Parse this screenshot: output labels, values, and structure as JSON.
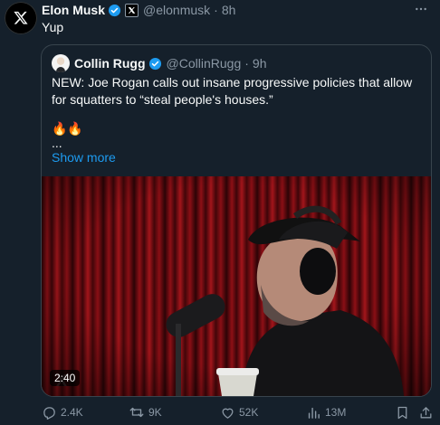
{
  "tweet": {
    "author_name": "Elon Musk",
    "author_handle": "@elonmusk",
    "separator": "·",
    "time": "8h",
    "text": "Yup",
    "more_icon": "ellipsis-icon"
  },
  "quoted": {
    "author_name": "Collin Rugg",
    "author_handle": "@CollinRugg",
    "separator": "·",
    "time": "9h",
    "text": "NEW: Joe Rogan calls out insane progressive policies that allow for squatters to “steal people's houses.”",
    "emoji": "🔥🔥",
    "ellipsis": "...",
    "show_more": "Show more",
    "video_duration": "2:40"
  },
  "actions": {
    "replies": "2.4K",
    "reposts": "9K",
    "likes": "52K",
    "views": "13M"
  },
  "colors": {
    "background": "#15202b",
    "text": "#f7f9f9",
    "muted": "#8b98a5",
    "accent": "#1d9bf0",
    "border": "#38444d"
  }
}
